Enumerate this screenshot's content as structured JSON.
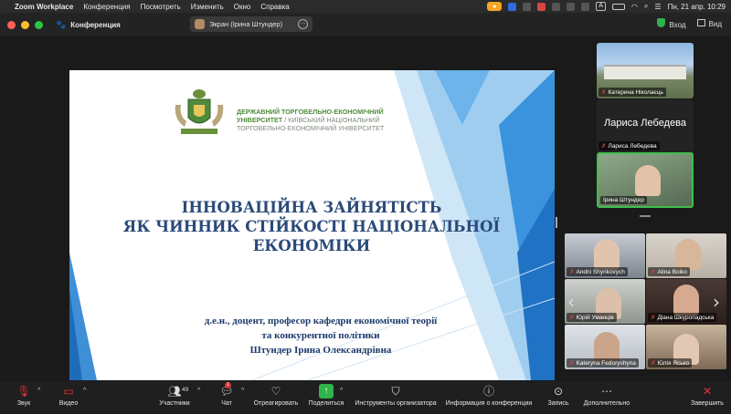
{
  "menubar": {
    "apple": "",
    "app_name": "Zoom Workplace",
    "items": [
      "Конференция",
      "Посмотреть",
      "Изменить",
      "Окно",
      "Справка"
    ],
    "input_indicator": "A",
    "datetime": "Пн, 21 апр.  10:29"
  },
  "titlebar": {
    "meeting_label": "Конференция",
    "share_pill": "Экран (Ірина Штундер)",
    "login_label": "Вход",
    "view_label": "Вид"
  },
  "slide": {
    "university_green": "ДЕРЖАВНИЙ ТОРГОВЕЛЬНО-ЕКОНОМІЧНИЙ УНІВЕРСИТЕТ",
    "university_grey": " / КИЇВСЬКИЙ НАЦІОНАЛЬНИЙ ТОРГОВЕЛЬНО-ЕКОНОМІЧНИЙ УНІВЕРСИТЕТ",
    "title_line1": "ІННОВАЦІЙНА ЗАЙНЯТІСТЬ",
    "title_line2": "ЯК ЧИННИК СТІЙКОСТІ НАЦІОНАЛЬНОЇ",
    "title_line3": "ЕКОНОМІКИ",
    "author_line1": "д.е.н., доцент, професор кафедри економічної теорії",
    "author_line2": "та конкурентної політики",
    "author_line3": "Штундер Ірина Олександрівна"
  },
  "speakers": [
    {
      "name": "Катерина Ніколаєць"
    },
    {
      "name": "Лариса Лебедева",
      "big_name": "Лариса Лебедева"
    },
    {
      "name": "Ірина Штундер"
    }
  ],
  "grid": [
    {
      "name": "Andrii Shynkovych"
    },
    {
      "name": "Alina Boiko"
    },
    {
      "name": "Юрій Уманців"
    },
    {
      "name": "Діана Шкуропадська"
    },
    {
      "name": "Kateryna Fedoryshyna"
    },
    {
      "name": "Юлія Ясько"
    }
  ],
  "toolbar": {
    "audio": "Звук",
    "video": "Видео",
    "participants": "Участники",
    "participants_count": "49",
    "chat": "Чат",
    "chat_badge": "1",
    "react": "Отреагировать",
    "share": "Поделиться",
    "host_tools": "Инструменты организатора",
    "info": "Информация о конференции",
    "record": "Запись",
    "more": "Дополнительно",
    "end": "Завершить"
  },
  "colors": {
    "slide_title": "#2b4a7a",
    "university_green": "#4e8c3a",
    "active_speaker_border": "#3fbf4d",
    "end_red": "#e0343a",
    "share_green": "#2fb34a"
  }
}
